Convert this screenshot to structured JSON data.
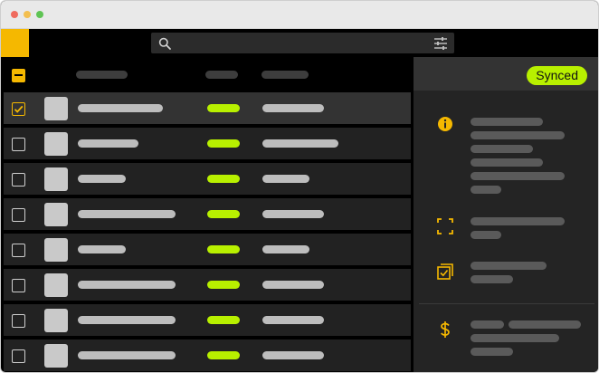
{
  "window": {
    "controls": [
      "close",
      "minimize",
      "maximize"
    ]
  },
  "toolbar": {
    "logo": "app-logo",
    "search_icon": "search-icon",
    "filter_icon": "sliders-icon",
    "search_value": "",
    "search_placeholder": ""
  },
  "list": {
    "header_checkbox": "indeterminate",
    "rows": [
      {
        "selected": true,
        "checked": true
      },
      {
        "selected": false,
        "checked": false
      },
      {
        "selected": false,
        "checked": false
      },
      {
        "selected": false,
        "checked": false
      },
      {
        "selected": false,
        "checked": false
      },
      {
        "selected": false,
        "checked": false
      },
      {
        "selected": false,
        "checked": false
      },
      {
        "selected": false,
        "checked": false
      }
    ]
  },
  "panel": {
    "status_label": "Synced",
    "icons": [
      "info-icon",
      "fullscreen-icon",
      "copy-check-icon",
      "dollar-icon"
    ]
  },
  "colors": {
    "accent_yellow": "#f5b800",
    "accent_lime": "#b8f000",
    "row_bg": "#222222",
    "row_selected_bg": "#333333",
    "panel_bg": "#242424"
  }
}
